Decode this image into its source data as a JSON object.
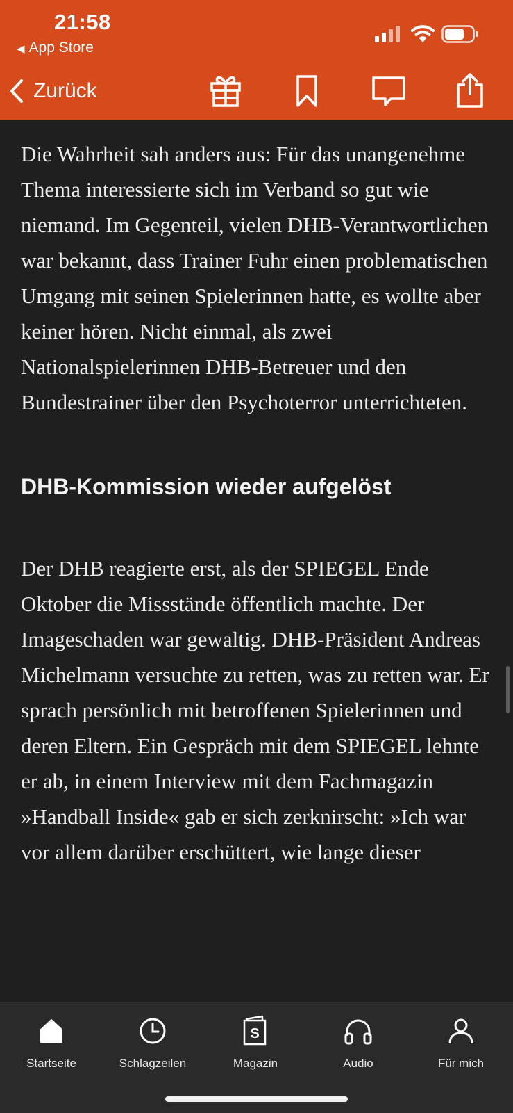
{
  "status_bar": {
    "time": "21:58",
    "back_app": "App Store"
  },
  "toolbar": {
    "back_label": "Zurück",
    "icons": [
      "gift-icon",
      "bookmark-icon",
      "comment-icon",
      "share-icon"
    ]
  },
  "article": {
    "paragraph_1": "Die Wahrheit sah anders aus: Für das unangenehme Thema interessierte sich im Verband so gut wie niemand. Im Gegenteil, vielen DHB-Verantwortlichen war bekannt, dass Trainer Fuhr einen problematischen Umgang mit seinen Spielerinnen hatte, es wollte aber keiner hören. Nicht einmal, als zwei Nationalspielerinnen DHB-Betreuer und den Bundestrainer über den Psychoterror unterrichteten.",
    "heading": "DHB-Kommission wieder aufgelöst",
    "paragraph_2": "Der DHB reagierte erst, als der SPIEGEL Ende Oktober die Missstände öffentlich machte. Der Imageschaden war gewaltig. DHB-Präsident Andreas Michelmann versuchte zu retten, was zu retten war. Er sprach persönlich mit betroffenen Spielerinnen und deren Eltern. Ein Gespräch mit dem SPIEGEL lehnte er ab, in einem Interview mit dem Fachmagazin »Handball Inside« gab er sich zerknirscht: »Ich war vor allem darüber erschüttert, wie lange dieser"
  },
  "tabbar": {
    "tabs": [
      {
        "label": "Startseite",
        "icon": "home-icon"
      },
      {
        "label": "Schlagzeilen",
        "icon": "clock-icon"
      },
      {
        "label": "Magazin",
        "icon": "magazine-icon"
      },
      {
        "label": "Audio",
        "icon": "headphones-icon"
      },
      {
        "label": "Für mich",
        "icon": "person-icon"
      }
    ]
  },
  "colors": {
    "accent": "#d64a1c",
    "background": "#1f1f1f",
    "tabbar": "#2a2a2a",
    "text": "#ececec"
  }
}
